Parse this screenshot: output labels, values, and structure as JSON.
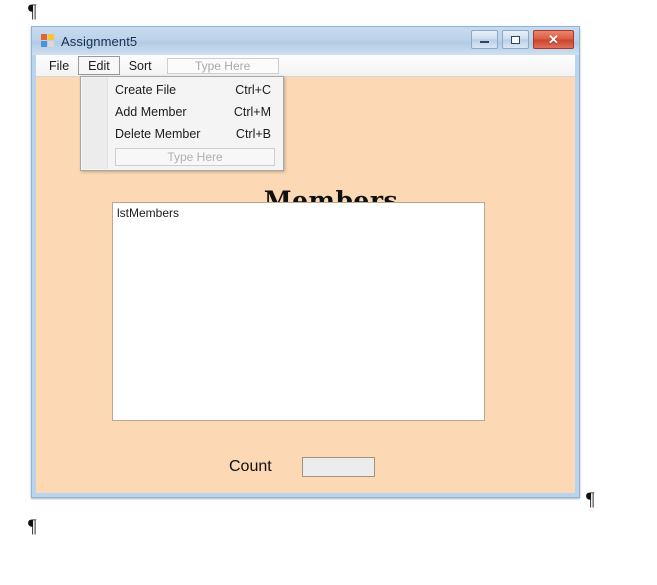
{
  "document": {
    "paragraph_mark": "¶"
  },
  "window": {
    "title": "Assignment5",
    "icon": "winforms-app-icon",
    "controls": {
      "minimize_label": "–",
      "maximize_label": "□",
      "close_label": "✕"
    }
  },
  "menu_strip": {
    "items": [
      {
        "label": "File",
        "selected": false
      },
      {
        "label": "Edit",
        "selected": true
      },
      {
        "label": "Sort",
        "selected": false
      }
    ],
    "type_here_placeholder": "Type Here"
  },
  "edit_dropdown": {
    "open": true,
    "items": [
      {
        "label": "Create File",
        "shortcut": "Ctrl+C"
      },
      {
        "label": "Add Member",
        "shortcut": "Ctrl+M"
      },
      {
        "label": "Delete Member",
        "shortcut": "Ctrl+B"
      }
    ],
    "type_here_placeholder": "Type Here"
  },
  "form": {
    "heading": "Members",
    "listbox_name": "lstMembers",
    "listbox_items": [],
    "count_label": "Count",
    "count_value": ""
  },
  "colors": {
    "form_background": "#FCD9B4",
    "window_border": "#B9D4EE",
    "titlebar_text": "#15314F",
    "close_button": "#DC5A3F",
    "listbox_border": "#B8A894"
  }
}
